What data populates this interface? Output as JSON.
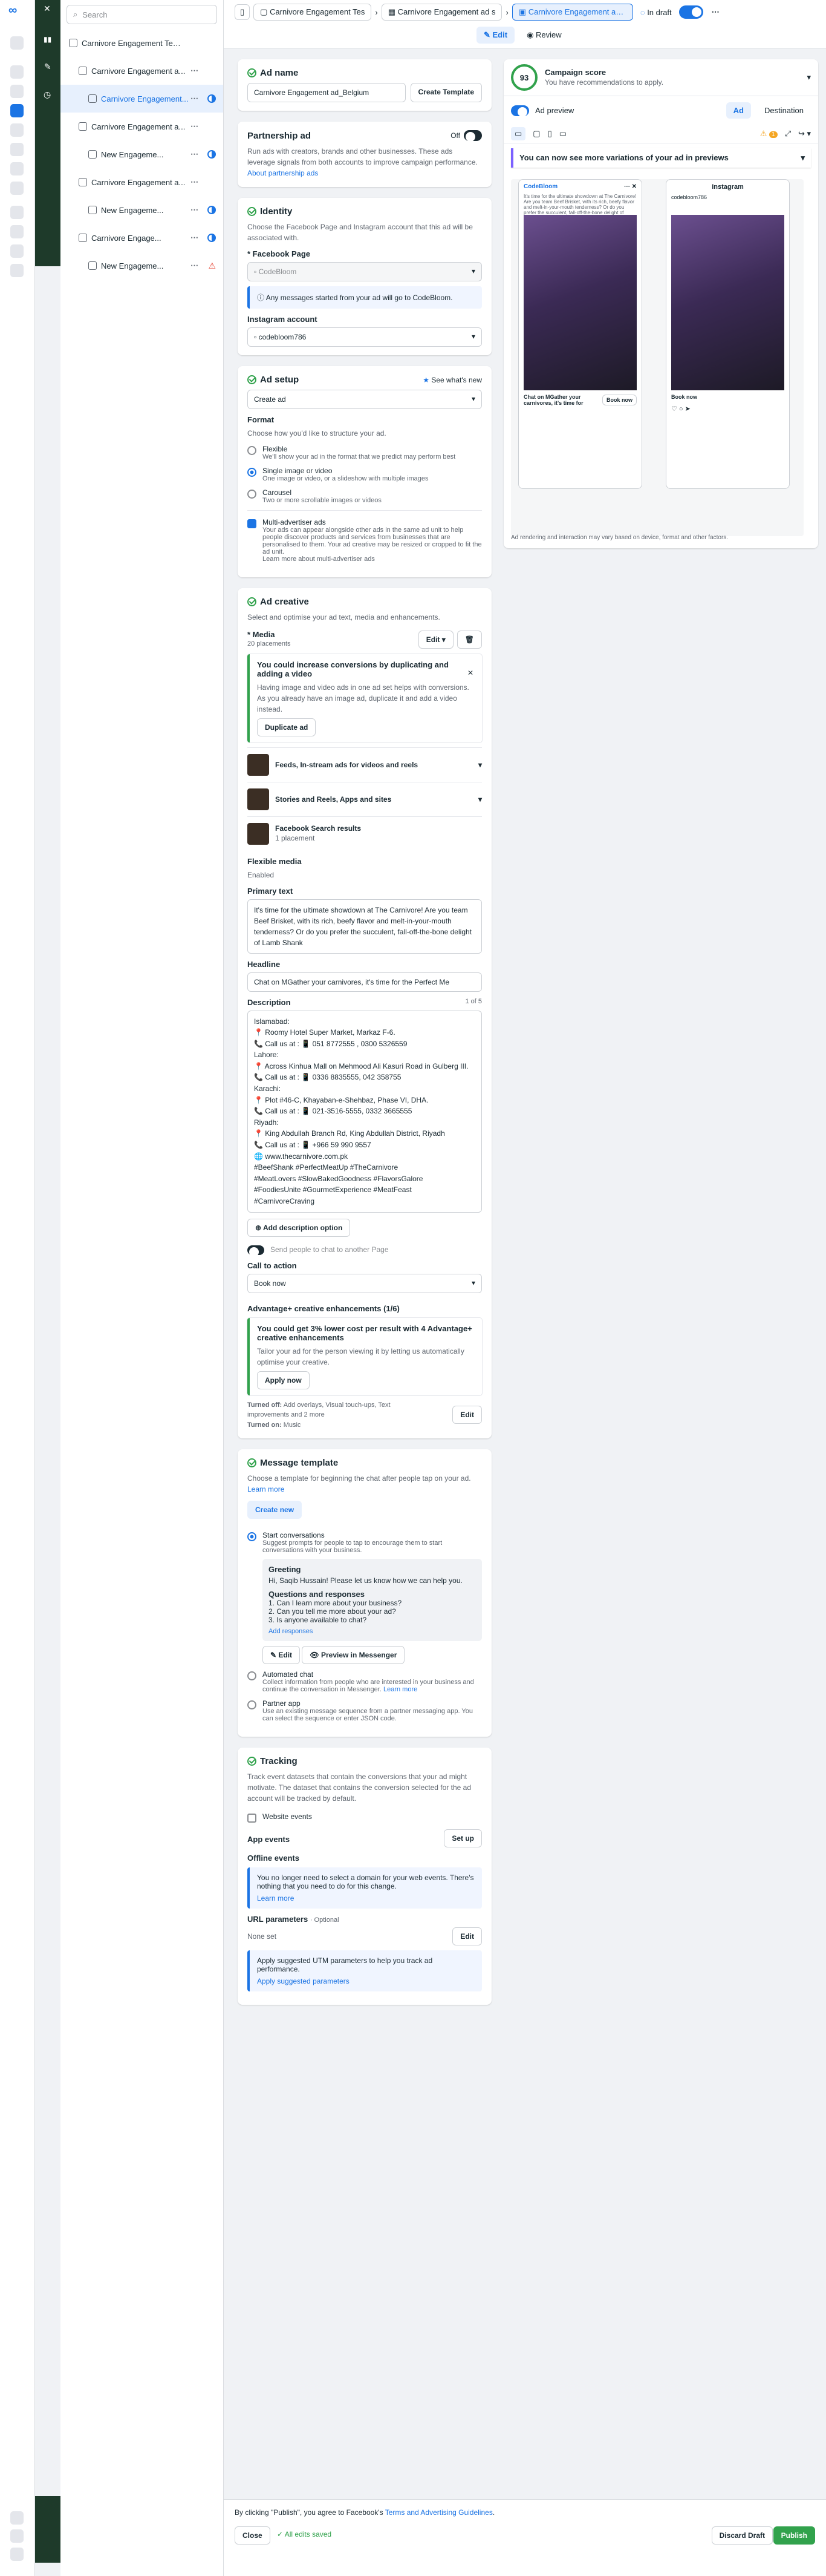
{
  "search": {
    "placeholder": "Search"
  },
  "tree": [
    {
      "label": "Carnivore Engagement Test...",
      "level": 0,
      "dots": false
    },
    {
      "label": "Carnivore Engagement a...",
      "level": 1,
      "dots": true,
      "status": "none"
    },
    {
      "label": "Carnivore Engagement...",
      "level": 2,
      "dots": true,
      "status": "half",
      "selected": true
    },
    {
      "label": "Carnivore Engagement a...",
      "level": 1,
      "dots": true,
      "status": "none"
    },
    {
      "label": "New Engageme...",
      "level": 2,
      "dots": true,
      "status": "half"
    },
    {
      "label": "Carnivore Engagement a...",
      "level": 1,
      "dots": true,
      "status": "none"
    },
    {
      "label": "New Engageme...",
      "level": 2,
      "dots": true,
      "status": "half"
    },
    {
      "label": "Carnivore Engage...",
      "level": 1,
      "dots": true,
      "status": "half"
    },
    {
      "label": "New Engageme...",
      "level": 2,
      "dots": true,
      "status": "warn"
    }
  ],
  "breadcrumbs": [
    "Carnivore Engagement Tes",
    "Carnivore Engagement ad s",
    "Carnivore Engagement ad B"
  ],
  "status": {
    "label": "In draft"
  },
  "tabs": {
    "edit": "Edit",
    "review": "Review"
  },
  "ad_name": {
    "title": "Ad name",
    "value": "Carnivore Engagement ad_Belgium",
    "button": "Create Template"
  },
  "partnership": {
    "title": "Partnership ad",
    "toggle": "Off",
    "text": "Run ads with creators, brands and other businesses. These ads leverage signals from both accounts to improve campaign performance.",
    "link": "About partnership ads"
  },
  "identity": {
    "title": "Identity",
    "text": "Choose the Facebook Page and Instagram account that this ad will be associated with.",
    "fb_label": "* Facebook Page",
    "fb_value": "CodeBloom",
    "notice": "Any messages started from your ad will go to CodeBloom.",
    "ig_label": "Instagram account",
    "ig_value": "codebloom786"
  },
  "ad_setup": {
    "title": "Ad setup",
    "whats_new": "See what's new",
    "select": "Create ad",
    "format_label": "Format",
    "format_sub": "Choose how you'd like to structure your ad.",
    "options": [
      {
        "title": "Flexible",
        "sub": "We'll show your ad in the format that we predict may perform best",
        "on": false
      },
      {
        "title": "Single image or video",
        "sub": "One image or video, or a slideshow with multiple images",
        "on": true
      },
      {
        "title": "Carousel",
        "sub": "Two or more scrollable images or videos",
        "on": false
      }
    ],
    "multi_title": "Multi-advertiser ads",
    "multi_text": "Your ads can appear alongside other ads in the same ad unit to help people discover products and services from businesses that are personalised to them. Your ad creative may be resized or cropped to fit the ad unit.",
    "multi_link": "Learn more about multi-advertiser ads"
  },
  "creative": {
    "title": "Ad creative",
    "text": "Select and optimise your ad text, media and enhancements.",
    "media_label": "* Media",
    "placements": "20 placements",
    "edit": "Edit",
    "tip_title": "You could increase conversions by duplicating and adding a video",
    "tip_text": "Having image and video ads in one ad set helps with conversions. As you already have an image ad, duplicate it and add a video instead.",
    "tip_button": "Duplicate ad",
    "placement_rows": [
      {
        "title": "Feeds, In-stream ads for videos and reels",
        "sub": ""
      },
      {
        "title": "Stories and Reels, Apps and sites",
        "sub": ""
      },
      {
        "title": "Facebook Search results",
        "sub": "1 placement"
      }
    ],
    "flex_title": "Flexible media",
    "flex_value": "Enabled",
    "primary_label": "Primary text",
    "primary_text": "It's time for the ultimate showdown at The Carnivore! Are you team Beef Brisket, with its rich, beefy flavor and melt-in-your-mouth tenderness? Or do you prefer the succulent, fall-off-the-bone delight of Lamb Shank",
    "headline_label": "Headline",
    "headline_text": "Chat on MGather your carnivores, it's time for the Perfect Me",
    "desc_label": "Description",
    "desc_count": "1 of 5",
    "desc_lines": [
      "Islamabad:",
      "📍 Roomy Hotel Super Market, Markaz F-6.",
      "📞 Call us at : 📱 051 8772555 , 0300 5326559",
      "Lahore:",
      "📍 Across Kinhua Mall on Mehmood Ali Kasuri Road in Gulberg III.",
      "📞 Call us at : 📱 0336 8835555, 042 358755",
      "Karachi:",
      "📍 Plot #46-C, Khayaban-e-Shehbaz, Phase VI, DHA.",
      "📞 Call us at : 📱 021-3516-5555, 0332 3665555",
      "Riyadh:",
      "📍 King Abdullah Branch Rd, King Abdullah District, Riyadh",
      "📞 Call us at : 📱 +966 59 990 9557",
      "🌐 www.thecarnivore.com.pk",
      "#BeefShank #PerfectMeatUp #TheCarnivore",
      "#MeatLovers #SlowBakedGoodness #FlavorsGalore",
      "#FoodiesUnite #GourmetExperience #MeatFeast",
      "#CarnivoreCraving"
    ],
    "add_desc": "Add description option",
    "send_people": "Send people to chat to another Page",
    "cta_label": "Call to action",
    "cta_value": "Book now",
    "adv_label": "Advantage+ creative enhancements (1/6)",
    "adv_tip_title": "You could get 3% lower cost per result with 4 Advantage+ creative enhancements",
    "adv_tip_text": "Tailor your ad for the person viewing it by letting us automatically optimise your creative.",
    "adv_tip_button": "Apply now",
    "turned_off_label": "Turned off:",
    "turned_off": "Add overlays, Visual touch-ups, Text improvements and 2 more",
    "turned_on_label": "Turned on:",
    "turned_on": "Music",
    "edit2": "Edit"
  },
  "message": {
    "title": "Message template",
    "text": "Choose a template for beginning the chat after people tap on your ad.",
    "link": "Learn more",
    "create": "Create new",
    "start_title": "Start conversations",
    "start_sub": "Suggest prompts for people to tap to encourage them to start conversations with your business.",
    "greeting_label": "Greeting",
    "greeting": "Hi, Saqib Hussain! Please let us know how we can help you.",
    "qr_label": "Questions and responses",
    "questions": [
      "1. Can I learn more about your business?",
      "2. Can you tell me more about your ad?",
      "3. Is anyone available to chat?"
    ],
    "add_responses": "Add responses",
    "edit": "Edit",
    "preview": "Preview in Messenger",
    "auto_title": "Automated chat",
    "auto_sub": "Collect information from people who are interested in your business and continue the conversation in Messenger.",
    "auto_link": "Learn more",
    "partner_title": "Partner app",
    "partner_sub": "Use an existing message sequence from a partner messaging app. You can select the sequence or enter JSON code."
  },
  "tracking": {
    "title": "Tracking",
    "text": "Track event datasets that contain the conversions that your ad might motivate. The dataset that contains the conversion selected for the ad account will be tracked by default.",
    "website": "Website events",
    "app": "App events",
    "setup": "Set up",
    "offline": "Offline events",
    "notice": "You no longer need to select a domain for your web events. There's nothing that you need to do for this change.",
    "notice_link": "Learn more",
    "url_label": "URL parameters",
    "url_opt": "· Optional",
    "url_value": "None set",
    "url_edit": "Edit",
    "utm_text": "Apply suggested UTM parameters to help you track ad performance.",
    "utm_link": "Apply suggested parameters"
  },
  "preview": {
    "score": "93",
    "score_title": "Campaign score",
    "score_sub": "You have recommendations to apply.",
    "ad_preview": "Ad preview",
    "tab_ad": "Ad",
    "tab_dest": "Destination",
    "variations": "You can now see more variations of your ad in previews",
    "footer": "Ad rendering and interaction may vary based on device, format and other factors.",
    "fb_page": "CodeBloom",
    "ig_label": "Instagram",
    "book": "Book now",
    "chat": "Chat on MGather your carnivores, it's time for",
    "warn_count": "1"
  },
  "bottom": {
    "terms_pre": "By clicking \"Publish\", you agree to Facebook's",
    "terms_link": "Terms and Advertising Guidelines",
    "close": "Close",
    "saved": "All edits saved",
    "discard": "Discard Draft",
    "publish": "Publish"
  }
}
